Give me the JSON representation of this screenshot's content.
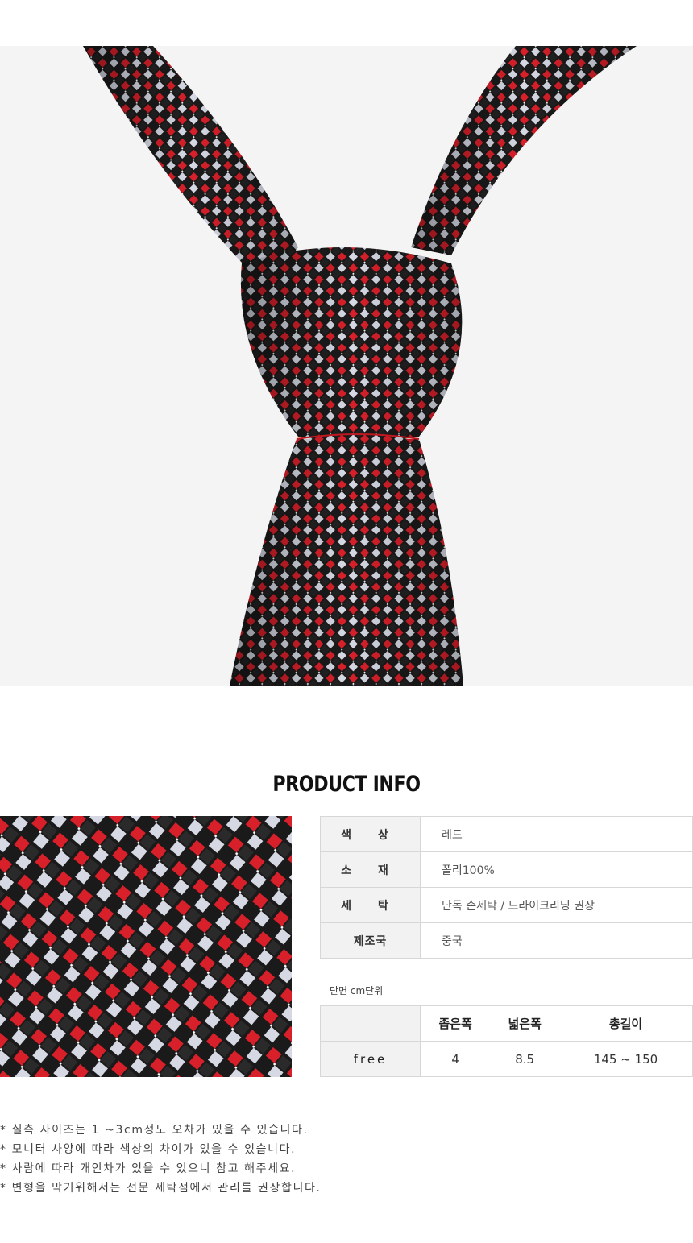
{
  "product_info": {
    "title": "PRODUCT INFO",
    "rows": [
      {
        "label": "색 상",
        "value": "레드"
      },
      {
        "label": "소 재",
        "value": "폴리100%"
      },
      {
        "label": "세 탁",
        "value": "단독 손세탁 / 드라이크리닝 권장"
      },
      {
        "label": "제조국",
        "value": "중국"
      }
    ]
  },
  "size": {
    "unit_note": "단면 cm단위",
    "headers": [
      "",
      "좁은폭",
      "넓은폭",
      "총길이"
    ],
    "row": [
      "free",
      "4",
      "8.5",
      "145 ~ 150"
    ]
  },
  "notes": [
    "* 실측 사이즈는 1 ~3cm정도 오차가 있을 수 있습니다.",
    "* 모니터 사양에 따라 색상의 차이가 있을 수 있습니다.",
    "* 사람에 따라 개인차가 있을 수 있으니 참고 해주세요.",
    "* 변형을 막기위해서는 전문 세탁점에서 관리를 권장합니다."
  ],
  "colors": {
    "red": "#d8202a",
    "black": "#1a1a1a",
    "silver": "#d6d9e4",
    "background": "#f4f4f4"
  }
}
